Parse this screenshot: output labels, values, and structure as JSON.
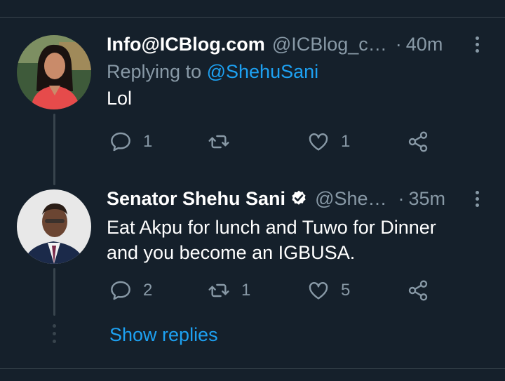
{
  "tweets": [
    {
      "name": "Info@ICBlog.com",
      "handle": "@ICBlog_c…",
      "separator": "·",
      "time": "40m",
      "replying_prefix": "Replying to",
      "replying_to": "@ShehuSani",
      "text": "Lol",
      "verified": false,
      "replies": "1",
      "retweets": "",
      "likes": "1"
    },
    {
      "name": "Senator Shehu Sani",
      "handle": "@She…",
      "separator": "·",
      "time": "35m",
      "text_line1": "Eat Akpu for lunch and Tuwo for Dinner",
      "text_line2": "and you become an IGBUSA.",
      "verified": true,
      "replies": "2",
      "retweets": "1",
      "likes": "5"
    }
  ],
  "show_replies_label": "Show replies",
  "colors": {
    "background": "#15202b",
    "divider": "#38444d",
    "secondary_text": "#8899a6",
    "accent": "#1da1f2",
    "primary_text": "#ffffff"
  },
  "icons": [
    "reply-icon",
    "retweet-icon",
    "like-icon",
    "share-icon",
    "more-icon",
    "verified-badge-icon"
  ]
}
